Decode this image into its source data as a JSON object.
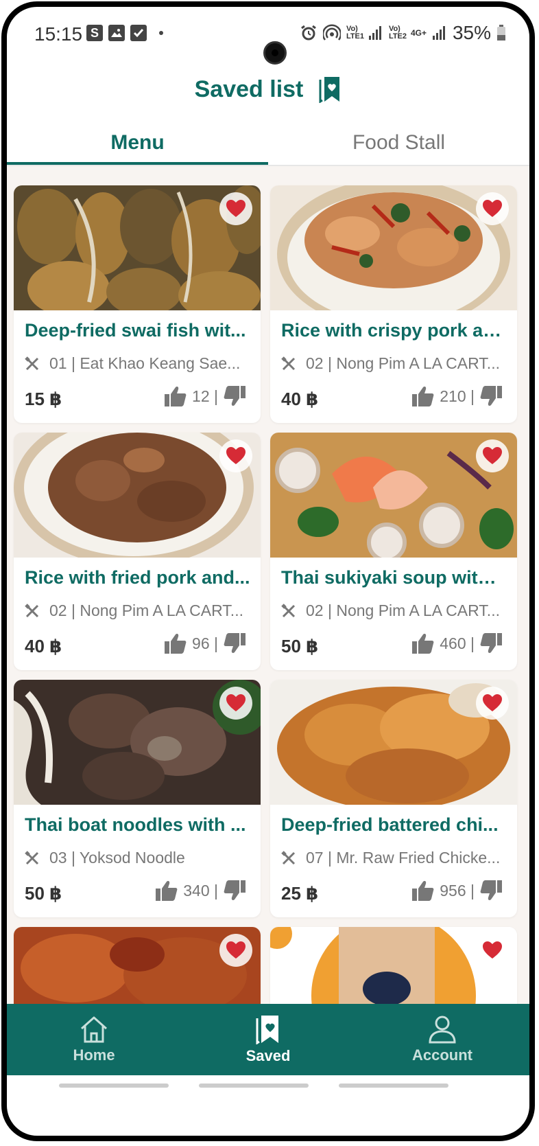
{
  "status_bar": {
    "time": "15:15",
    "battery": "35%",
    "left_icons": [
      "s-icon",
      "image-icon",
      "check-icon"
    ],
    "right_icons": [
      "alarm-icon",
      "hotspot-icon",
      "volte-lte1-icon",
      "signal-icon",
      "volte-lte2-icon",
      "4g-icon",
      "signal-icon",
      "battery-icon"
    ],
    "lte1_label": "Vo) LTE1",
    "lte2_label": "Vo) LTE2",
    "fourg_label": "4G+"
  },
  "header": {
    "title": "Saved list",
    "icon": "bookmark-heart-icon"
  },
  "tabs": [
    {
      "label": "Menu",
      "active": true
    },
    {
      "label": "Food Stall",
      "active": false
    }
  ],
  "colors": {
    "brand": "#0f6b63",
    "heart": "#d62b36",
    "bg": "#f8f4f1"
  },
  "items": [
    {
      "title": "Deep-fried swai fish wit...",
      "stall": "01 | Eat Khao Keang Sae...",
      "price": "15 ฿",
      "likes": "12 |",
      "image": "fried-fish-photo"
    },
    {
      "title": "Rice with crispy pork an...",
      "stall": "02 | Nong Pim A LA CART...",
      "price": "40 ฿",
      "likes": "210 |",
      "image": "crispy-pork-rice-photo"
    },
    {
      "title": "Rice with fried pork and...",
      "stall": "02 | Nong Pim A LA CART...",
      "price": "40 ฿",
      "likes": "96 |",
      "image": "fried-pork-rice-photo"
    },
    {
      "title": "Thai sukiyaki soup with ...",
      "stall": "02 | Nong Pim A LA CART...",
      "price": "50 ฿",
      "likes": "460 |",
      "image": "sukiyaki-soup-photo"
    },
    {
      "title": "Thai boat noodles with ...",
      "stall": "03 | Yoksod Noodle",
      "price": "50 ฿",
      "likes": "340 |",
      "image": "boat-noodles-photo"
    },
    {
      "title": "Deep-fried battered chi...",
      "stall": "07 | Mr. Raw Fried Chicke...",
      "price": "25 ฿",
      "likes": "956 |",
      "image": "fried-chicken-photo"
    }
  ],
  "partial_items": [
    {
      "image": "fried-chicken-2-photo"
    },
    {
      "image": "thai-tea-photo"
    }
  ],
  "bottom_nav": [
    {
      "label": "Home",
      "icon": "home-icon",
      "active": false
    },
    {
      "label": "Saved",
      "icon": "bookmark-heart-icon",
      "active": true
    },
    {
      "label": "Account",
      "icon": "user-icon",
      "active": false
    }
  ]
}
